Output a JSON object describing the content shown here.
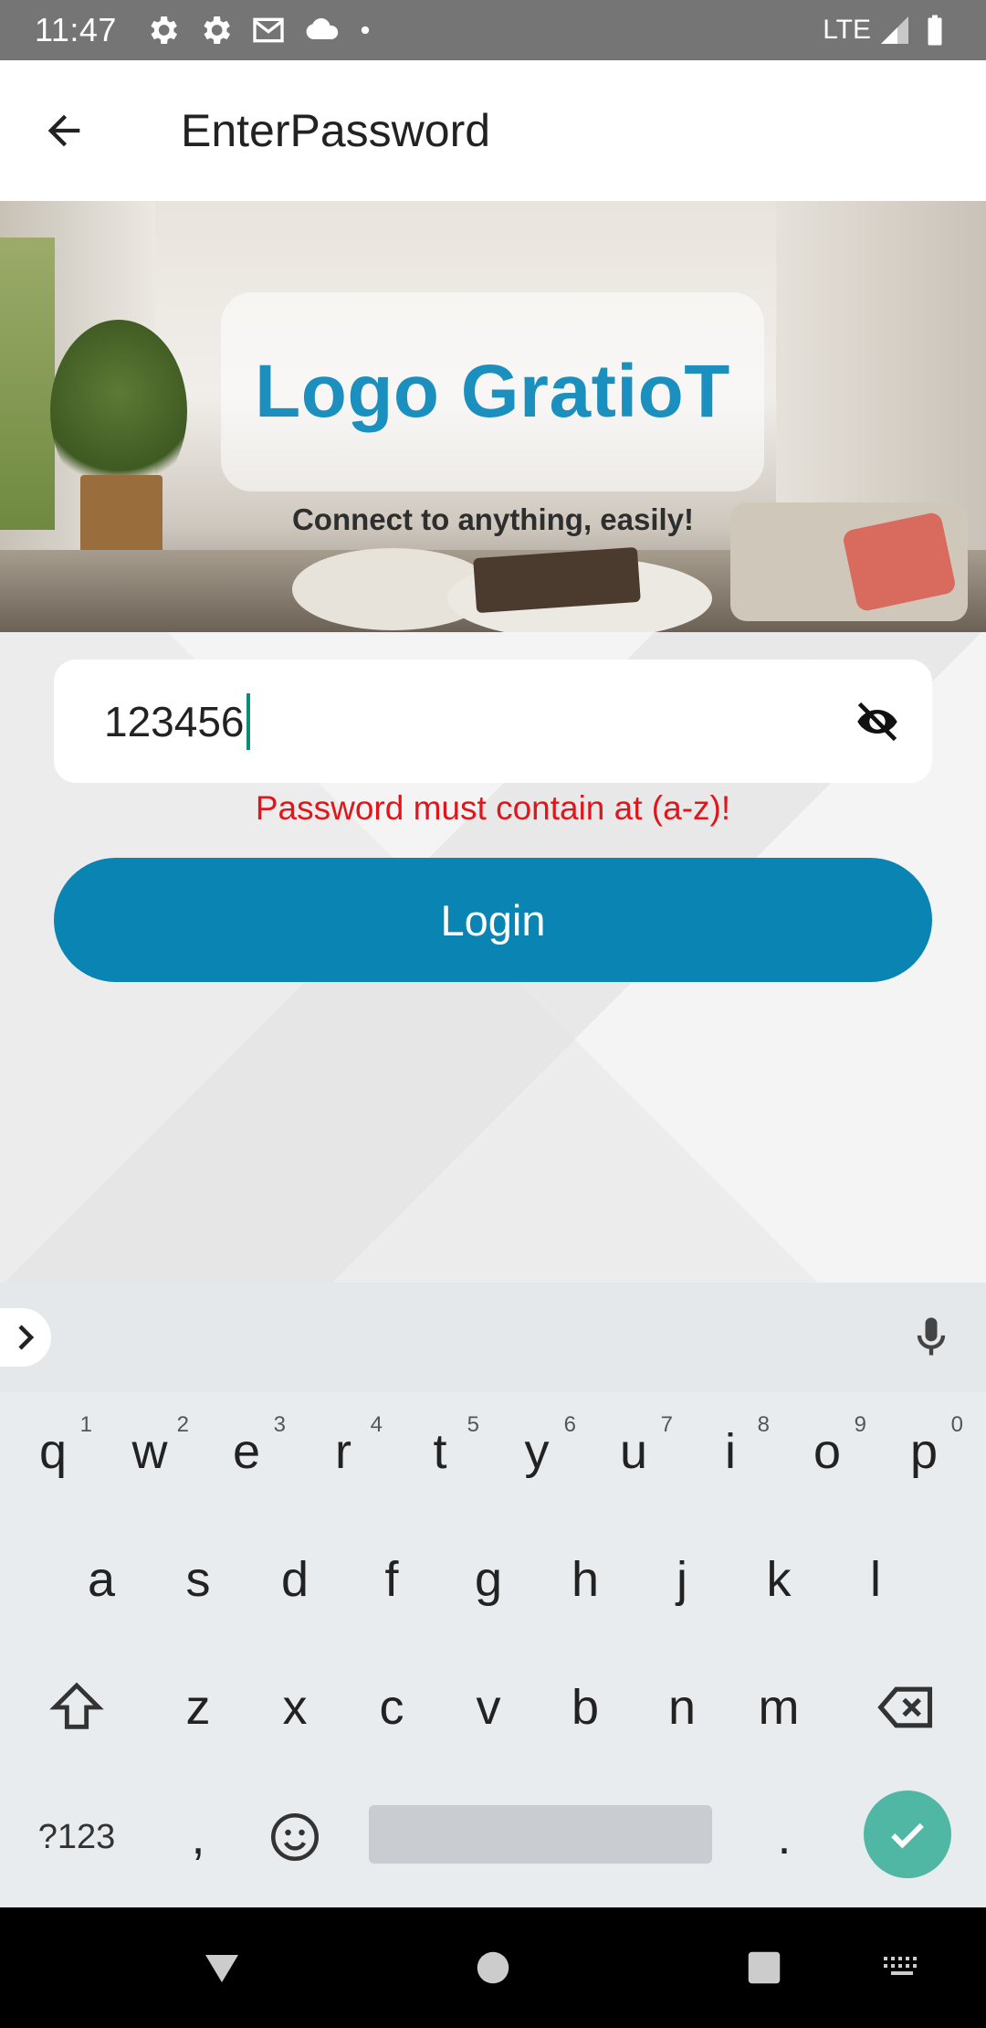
{
  "status_bar": {
    "time": "11:47",
    "network": "LTE",
    "icons": [
      "settings-icon",
      "settings-icon",
      "gmail-icon",
      "cloud-icon",
      "dot-icon",
      "signal-icon",
      "battery-icon"
    ]
  },
  "app_bar": {
    "title": "EnterPassword",
    "back_icon": "arrow-back-icon"
  },
  "hero": {
    "logo_text": "Logo GratioT",
    "tagline": "Connect to anything, easily!"
  },
  "form": {
    "password_value": "123456",
    "visibility_icon": "eye-off-icon",
    "error": "Password must contain at (a-z)!",
    "login_label": "Login"
  },
  "keyboard": {
    "row1": [
      {
        "key": "q",
        "hint": "1"
      },
      {
        "key": "w",
        "hint": "2"
      },
      {
        "key": "e",
        "hint": "3"
      },
      {
        "key": "r",
        "hint": "4"
      },
      {
        "key": "t",
        "hint": "5"
      },
      {
        "key": "y",
        "hint": "6"
      },
      {
        "key": "u",
        "hint": "7"
      },
      {
        "key": "i",
        "hint": "8"
      },
      {
        "key": "o",
        "hint": "9"
      },
      {
        "key": "p",
        "hint": "0"
      }
    ],
    "row2": [
      "a",
      "s",
      "d",
      "f",
      "g",
      "h",
      "j",
      "k",
      "l"
    ],
    "row3": [
      "z",
      "x",
      "c",
      "v",
      "b",
      "n",
      "m"
    ],
    "symbols_key": "?123",
    "comma": ",",
    "period": "."
  },
  "colors": {
    "accent": "#0a84b3",
    "logo": "#1b8fbd",
    "error": "#e0161b",
    "enter_key": "#4fb7a4"
  }
}
